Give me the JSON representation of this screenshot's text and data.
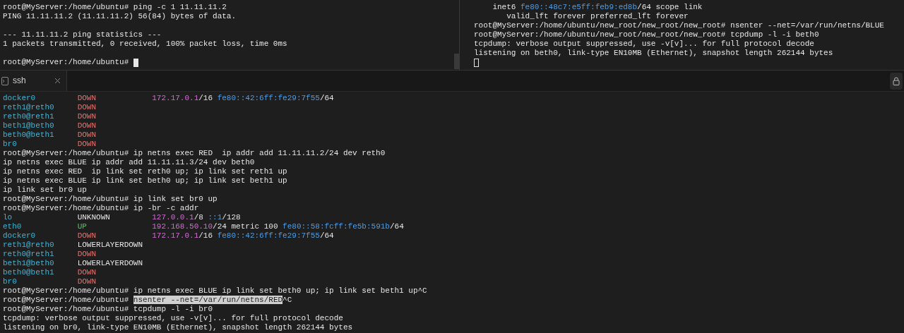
{
  "top_panes": [
    {
      "cursor_filled": true,
      "lines": [
        {
          "kind": "text",
          "segments": [
            {
              "kind": "plain",
              "text": "root@MyServer:/home/ubuntu# ping -c 1 11.11.11.2"
            }
          ]
        },
        {
          "kind": "text",
          "segments": [
            {
              "kind": "plain",
              "text": "PING 11.11.11.2 (11.11.11.2) 56(84) bytes of data."
            }
          ]
        },
        {
          "kind": "blank"
        },
        {
          "kind": "text",
          "segments": [
            {
              "kind": "plain",
              "text": "--- 11.11.11.2 ping statistics ---"
            }
          ]
        },
        {
          "kind": "text",
          "segments": [
            {
              "kind": "plain",
              "text": "1 packets transmitted, 0 received, 100% packet loss, time 0ms"
            }
          ]
        },
        {
          "kind": "blank"
        },
        {
          "kind": "cursor",
          "segments": [
            {
              "kind": "plain",
              "text": "root@MyServer:/home/ubuntu# "
            }
          ]
        }
      ]
    },
    {
      "cursor_filled": false,
      "lines": [
        {
          "kind": "text",
          "segments": [
            {
              "kind": "plain",
              "text": "    inet6 "
            },
            {
              "kind": "ipv6",
              "text": "fe80::48c7:e5ff:feb9:ed8b"
            },
            {
              "kind": "plain",
              "text": "/64 scope link"
            }
          ]
        },
        {
          "kind": "text",
          "segments": [
            {
              "kind": "plain",
              "text": "       valid_lft forever preferred_lft forever"
            }
          ]
        },
        {
          "kind": "text",
          "segments": [
            {
              "kind": "plain",
              "text": "root@MyServer:/home/ubuntu/new_root/new_root/new_root# nsenter --net=/var/run/netns/BLUE"
            }
          ]
        },
        {
          "kind": "text",
          "segments": [
            {
              "kind": "plain",
              "text": "root@MyServer:/home/ubuntu/new_root/new_root/new_root# tcpdump -l -i beth0"
            }
          ]
        },
        {
          "kind": "text",
          "segments": [
            {
              "kind": "plain",
              "text": "tcpdump: verbose output suppressed, use -v[v]... for full protocol decode"
            }
          ]
        },
        {
          "kind": "text",
          "segments": [
            {
              "kind": "plain",
              "text": "listening on beth0, link-type EN10MB (Ethernet), snapshot length 262144 bytes"
            }
          ]
        },
        {
          "kind": "cursor"
        }
      ]
    }
  ],
  "tabs": [
    {
      "label": "ssh",
      "selected": true
    }
  ],
  "terminal_lines": [
    [
      {
        "kind": "iface",
        "text": "docker0         "
      },
      {
        "kind": "down",
        "text": "DOWN            "
      },
      {
        "kind": "ipv4",
        "text": "172.17.0.1"
      },
      {
        "kind": "plain",
        "text": "/16 "
      },
      {
        "kind": "ipv6",
        "text": "fe80::42:6ff:fe29:7f55"
      },
      {
        "kind": "plain",
        "text": "/64"
      }
    ],
    [
      {
        "kind": "iface",
        "text": "reth1@reth0     "
      },
      {
        "kind": "down",
        "text": "DOWN"
      }
    ],
    [
      {
        "kind": "iface",
        "text": "reth0@reth1     "
      },
      {
        "kind": "down",
        "text": "DOWN"
      }
    ],
    [
      {
        "kind": "iface",
        "text": "beth1@beth0     "
      },
      {
        "kind": "down",
        "text": "DOWN"
      }
    ],
    [
      {
        "kind": "iface",
        "text": "beth0@beth1     "
      },
      {
        "kind": "down",
        "text": "DOWN"
      }
    ],
    [
      {
        "kind": "iface",
        "text": "br0             "
      },
      {
        "kind": "down",
        "text": "DOWN"
      }
    ],
    [
      {
        "kind": "plain",
        "text": "root@MyServer:/home/ubuntu# ip netns exec RED  ip addr add 11.11.11.2/24 dev reth0"
      }
    ],
    [
      {
        "kind": "plain",
        "text": "ip netns exec BLUE ip addr add 11.11.11.3/24 dev beth0"
      }
    ],
    [
      {
        "kind": "plain",
        "text": "ip netns exec RED  ip link set reth0 up; ip link set reth1 up"
      }
    ],
    [
      {
        "kind": "plain",
        "text": "ip netns exec BLUE ip link set beth0 up; ip link set beth1 up"
      }
    ],
    [
      {
        "kind": "plain",
        "text": "ip link set br0 up"
      }
    ],
    [
      {
        "kind": "plain",
        "text": "root@MyServer:/home/ubuntu# ip link set br0 up"
      }
    ],
    [
      {
        "kind": "plain",
        "text": "root@MyServer:/home/ubuntu# ip -br -c addr"
      }
    ],
    [
      {
        "kind": "iface",
        "text": "lo              "
      },
      {
        "kind": "plain",
        "text": "UNKNOWN         "
      },
      {
        "kind": "ipv4",
        "text": "127.0.0.1"
      },
      {
        "kind": "plain",
        "text": "/8 "
      },
      {
        "kind": "ipv6",
        "text": "::1"
      },
      {
        "kind": "plain",
        "text": "/128"
      }
    ],
    [
      {
        "kind": "iface",
        "text": "eth0            "
      },
      {
        "kind": "up",
        "text": "UP              "
      },
      {
        "kind": "ipv4",
        "text": "192.168.50.10"
      },
      {
        "kind": "plain",
        "text": "/24 metric 100 "
      },
      {
        "kind": "ipv6",
        "text": "fe80::58:fcff:fe5b:591b"
      },
      {
        "kind": "plain",
        "text": "/64"
      }
    ],
    [
      {
        "kind": "iface",
        "text": "docker0         "
      },
      {
        "kind": "down",
        "text": "DOWN            "
      },
      {
        "kind": "ipv4",
        "text": "172.17.0.1"
      },
      {
        "kind": "plain",
        "text": "/16 "
      },
      {
        "kind": "ipv6",
        "text": "fe80::42:6ff:fe29:7f55"
      },
      {
        "kind": "plain",
        "text": "/64"
      }
    ],
    [
      {
        "kind": "iface",
        "text": "reth1@reth0     "
      },
      {
        "kind": "plain",
        "text": "LOWERLAYERDOWN"
      }
    ],
    [
      {
        "kind": "iface",
        "text": "reth0@reth1     "
      },
      {
        "kind": "down",
        "text": "DOWN"
      }
    ],
    [
      {
        "kind": "iface",
        "text": "beth1@beth0     "
      },
      {
        "kind": "plain",
        "text": "LOWERLAYERDOWN"
      }
    ],
    [
      {
        "kind": "iface",
        "text": "beth0@beth1     "
      },
      {
        "kind": "down",
        "text": "DOWN"
      }
    ],
    [
      {
        "kind": "iface",
        "text": "br0             "
      },
      {
        "kind": "down",
        "text": "DOWN"
      }
    ],
    [
      {
        "kind": "plain",
        "text": "root@MyServer:/home/ubuntu# ip netns exec BLUE ip link set beth0 up; ip link set beth1 up^C"
      }
    ],
    [
      {
        "kind": "plain",
        "text": "root@MyServer:/home/ubuntu# "
      },
      {
        "kind": "selected",
        "text": "nsenter --net=/var/run/netns/RED"
      },
      {
        "kind": "plain",
        "text": "^C"
      }
    ],
    [
      {
        "kind": "plain",
        "text": "root@MyServer:/home/ubuntu# tcpdump -l -i br0"
      }
    ],
    [
      {
        "kind": "plain",
        "text": "tcpdump: verbose output suppressed, use -v[v]... for full protocol decode"
      }
    ],
    [
      {
        "kind": "plain",
        "text": "listening on br0, link-type EN10MB (Ethernet), snapshot length 262144 bytes"
      }
    ]
  ]
}
